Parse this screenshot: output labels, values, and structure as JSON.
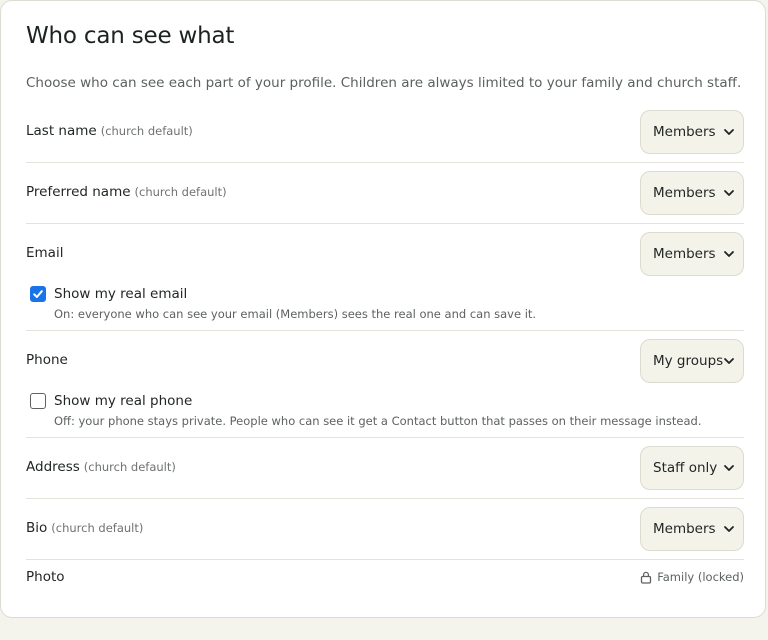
{
  "title": "Who can see what",
  "intro": "Choose who can see each part of your profile. Children are always limited to your family and church staff.",
  "fields": {
    "last_name": {
      "label": "Last name",
      "note": "(church default)",
      "value": "Members"
    },
    "preferred_name": {
      "label": "Preferred name",
      "note": "(church default)",
      "value": "Members"
    },
    "email": {
      "label": "Email",
      "value": "Members",
      "toggle_label": "Show my real email",
      "toggle_checked": true,
      "help": "On: everyone who can see your email (Members) sees the real one and can save it."
    },
    "phone": {
      "label": "Phone",
      "value": "My groups",
      "toggle_label": "Show my real phone",
      "toggle_checked": false,
      "help": "Off: your phone stays private. People who can see it get a Contact button that passes on their message instead."
    },
    "address": {
      "label": "Address",
      "note": "(church default)",
      "value": "Staff only"
    },
    "bio": {
      "label": "Bio",
      "note": "(church default)",
      "value": "Members"
    },
    "photo": {
      "label": "Photo",
      "locked_value": "Family (locked)"
    }
  },
  "colors": {
    "accent": "#1a73e8",
    "select_bg": "#f4f3ea",
    "page_bg": "#f4f3ec"
  },
  "icons": {
    "select": "chevron-down-icon",
    "locked": "lock-icon",
    "checked": "check-icon"
  }
}
